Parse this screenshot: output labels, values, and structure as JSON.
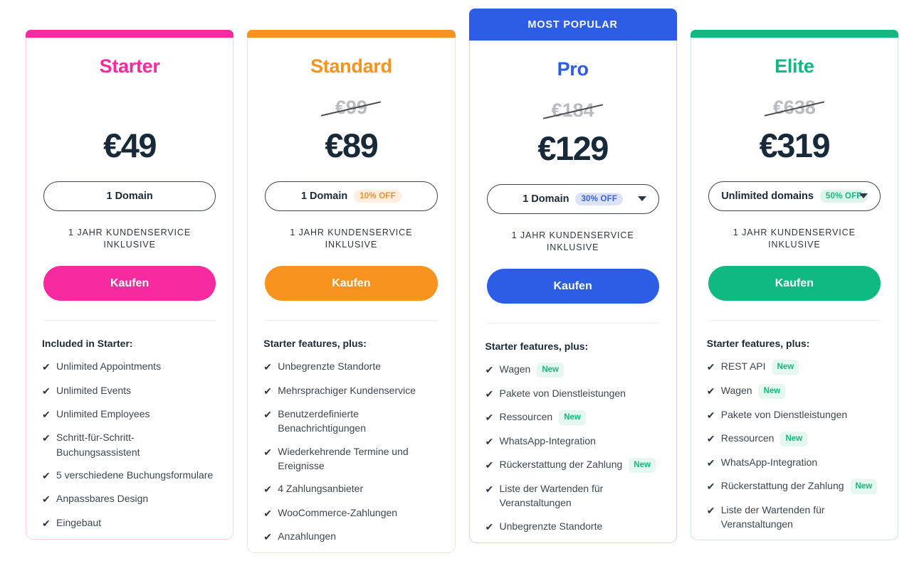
{
  "plans": [
    {
      "id": "starter",
      "name": "Starter",
      "accent": "#f72aa0",
      "border": "#f6d4e6",
      "badge_bg": "#fde4f2",
      "badge_color": "#f72aa0",
      "banner": "",
      "old_price": "",
      "price": "€49",
      "domain_label": "1 Domain",
      "discount": "",
      "has_caret": false,
      "service_note": "1 JAHR KUNDENSERVICE INKLUSIVE",
      "buy_label": "Kaufen",
      "features_title": "Included in Starter:",
      "features": [
        {
          "text": "Unlimited Appointments",
          "badge": ""
        },
        {
          "text": "Unlimited Events",
          "badge": ""
        },
        {
          "text": "Unlimited Employees",
          "badge": ""
        },
        {
          "text": "Schritt-für-Schritt-Buchungsassistent",
          "badge": ""
        },
        {
          "text": "5 verschiedene Buchungsformulare",
          "badge": ""
        },
        {
          "text": "Anpassbares Design",
          "badge": ""
        },
        {
          "text": "Eingebaut",
          "badge": ""
        }
      ]
    },
    {
      "id": "standard",
      "name": "Standard",
      "accent": "#f7931e",
      "border": "#f7e6cf",
      "badge_bg": "#fdeedd",
      "badge_color": "#f0922a",
      "banner": "",
      "old_price": "€99",
      "price": "€89",
      "domain_label": "1 Domain",
      "discount": "10% OFF",
      "has_caret": false,
      "service_note": "1 JAHR KUNDENSERVICE INKLUSIVE",
      "buy_label": "Kaufen",
      "features_title": "Starter features, plus:",
      "features": [
        {
          "text": "Unbegrenzte Standorte",
          "badge": ""
        },
        {
          "text": "Mehrsprachiger Kundenservice",
          "badge": ""
        },
        {
          "text": "Benutzerdefinierte Benachrichtigungen",
          "badge": ""
        },
        {
          "text": "Wiederkehrende Termine und Ereignisse",
          "badge": ""
        },
        {
          "text": "4 Zahlungsanbieter",
          "badge": ""
        },
        {
          "text": "WooCommerce-Zahlungen",
          "badge": ""
        },
        {
          "text": "Anzahlungen",
          "badge": ""
        }
      ]
    },
    {
      "id": "pro",
      "name": "Pro",
      "accent": "#2d5ce5",
      "border": "#cdd9f3",
      "badge_bg": "#dbe3fb",
      "badge_color": "#3e62d6",
      "banner": "MOST POPULAR",
      "old_price": "€184",
      "price": "€129",
      "domain_label": "1 Domain",
      "discount": "30% OFF",
      "has_caret": true,
      "service_note": "1 JAHR KUNDENSERVICE INKLUSIVE",
      "buy_label": "Kaufen",
      "features_title": "Starter features, plus:",
      "features": [
        {
          "text": "Wagen",
          "badge": "New"
        },
        {
          "text": "Pakete von Dienstleistungen",
          "badge": ""
        },
        {
          "text": "Ressourcen",
          "badge": "New"
        },
        {
          "text": "WhatsApp-Integration",
          "badge": ""
        },
        {
          "text": "Rückerstattung der Zahlung",
          "badge": "New"
        },
        {
          "text": "Liste der Wartenden für Veranstaltungen",
          "badge": ""
        },
        {
          "text": "Unbegrenzte Standorte",
          "badge": ""
        }
      ]
    },
    {
      "id": "elite",
      "name": "Elite",
      "accent": "#10b981",
      "border": "#c6e9dc",
      "badge_bg": "#def6ea",
      "badge_color": "#10b981",
      "banner": "",
      "old_price": "€638",
      "price": "€319",
      "domain_label": "Unlimited domains",
      "discount": "50% OFF",
      "has_caret": true,
      "service_note": "1 JAHR KUNDENSERVICE INKLUSIVE",
      "buy_label": "Kaufen",
      "features_title": "Starter features, plus:",
      "features": [
        {
          "text": "REST API",
          "badge": "New"
        },
        {
          "text": "Wagen",
          "badge": "New"
        },
        {
          "text": "Pakete von Dienstleistungen",
          "badge": ""
        },
        {
          "text": "Ressourcen",
          "badge": "New"
        },
        {
          "text": "WhatsApp-Integration",
          "badge": ""
        },
        {
          "text": "Rückerstattung der Zahlung",
          "badge": "New"
        },
        {
          "text": "Liste der Wartenden für Veranstaltungen",
          "badge": ""
        }
      ]
    }
  ],
  "icons": {
    "check": "✔",
    "caret": "caret-down-icon"
  }
}
